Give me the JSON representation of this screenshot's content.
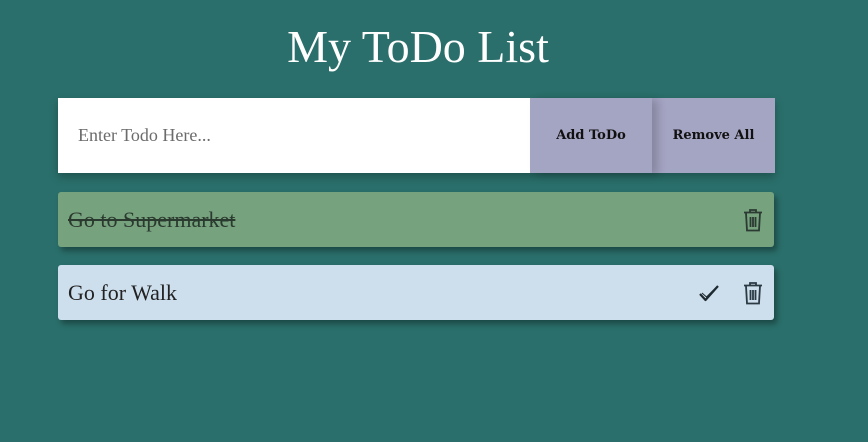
{
  "title": "My ToDo List",
  "form": {
    "input_placeholder": "Enter Todo Here...",
    "input_value": "",
    "add_label": "Add ToDo",
    "remove_all_label": "Remove All"
  },
  "todos": [
    {
      "text": "Go to Supermarket",
      "completed": true,
      "color": "#76a27e",
      "icons": [
        "trash-icon"
      ]
    },
    {
      "text": "Go for Walk",
      "completed": false,
      "color": "#cddeec",
      "icons": [
        "check-icon",
        "trash-icon"
      ]
    }
  ],
  "colors": {
    "background": "#2a6f6b",
    "button_area": "#a4a4c3",
    "title": "#ffffff"
  }
}
